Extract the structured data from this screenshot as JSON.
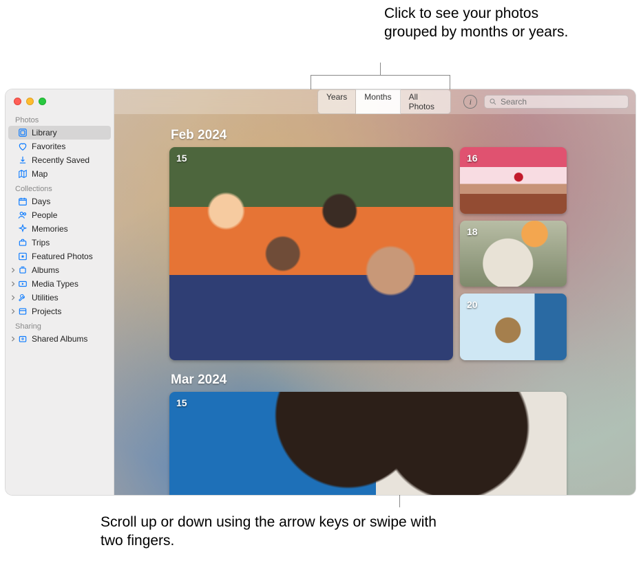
{
  "callouts": {
    "top": "Click to see your photos grouped by months or years.",
    "bottom": "Scroll up or down using the arrow keys or swipe with two fingers."
  },
  "toolbar": {
    "segments": {
      "years": "Years",
      "months": "Months",
      "all": "All Photos"
    },
    "search_placeholder": "Search"
  },
  "sidebar": {
    "sections": {
      "photos": {
        "header": "Photos",
        "library": "Library",
        "favorites": "Favorites",
        "recently_saved": "Recently Saved",
        "map": "Map"
      },
      "collections": {
        "header": "Collections",
        "days": "Days",
        "people": "People",
        "memories": "Memories",
        "trips": "Trips",
        "featured": "Featured Photos"
      },
      "albums": "Albums",
      "media_types": "Media Types",
      "utilities": "Utilities",
      "projects": "Projects",
      "sharing": {
        "header": "Sharing",
        "shared_albums": "Shared Albums"
      }
    }
  },
  "content": {
    "months": [
      {
        "label": "Feb 2024",
        "primary_day": "15",
        "side_days": [
          "16",
          "18",
          "20"
        ]
      },
      {
        "label": "Mar 2024",
        "primary_day": "15"
      }
    ]
  }
}
